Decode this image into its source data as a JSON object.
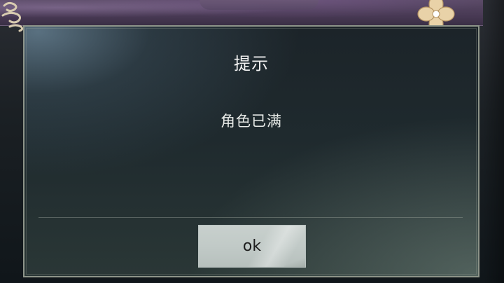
{
  "dialog": {
    "title": "提示",
    "message": "角色已满",
    "ok_label": "ok"
  },
  "icons": {
    "top_left": "cloud-ornament-icon",
    "top_right": "flower-ornament-icon"
  },
  "colors": {
    "banner": "#493a55",
    "dialog_border": "#8d9489",
    "button_face": "#c1cac7",
    "title_text": "#f2f2f2"
  }
}
